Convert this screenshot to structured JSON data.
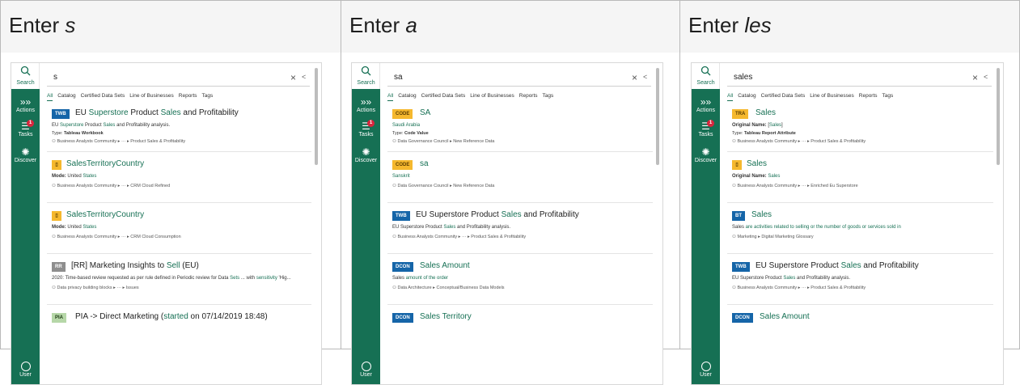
{
  "headers": [
    {
      "prefix": "Enter ",
      "term": "s"
    },
    {
      "prefix": "Enter ",
      "term": "a"
    },
    {
      "prefix": "Enter ",
      "term": "les"
    }
  ],
  "rail": {
    "search": "Search",
    "actions": "Actions",
    "tasks": "Tasks",
    "tasks_badge": "1",
    "discover": "Discover",
    "user": "User"
  },
  "tabs": [
    "All",
    "Catalog",
    "Certified Data Sets",
    "Line of Businesses",
    "Reports",
    "Tags"
  ],
  "panels": [
    {
      "query": "s",
      "results": [
        {
          "badge": "TWB",
          "title_parts": [
            "EU ",
            "Superstore",
            " Product ",
            "Sales",
            " and Profitability"
          ],
          "line1_parts": [
            "EU ",
            "Superstore",
            " Product ",
            "Sales",
            " and Profitability analysis."
          ],
          "line2_label": "Type:",
          "line2_value": "Tableau Workbook",
          "line3": "Business Analysts Community ▸ ··· ▸ Product Sales & Profitability"
        },
        {
          "badge": "▯",
          "title": "SalesTerritoryCountry",
          "line1_label": "Mode:",
          "line1_value_parts": [
            "United ",
            "States"
          ],
          "line3": "Business Analysts Community ▸ ··· ▸ CRM Cloud Refined"
        },
        {
          "badge": "▯",
          "title": "SalesTerritoryCountry",
          "line1_label": "Mode:",
          "line1_value_parts": [
            "United ",
            "States"
          ],
          "line3": "Business Analysts Community ▸ ··· ▸ CRM Cloud Consumption"
        },
        {
          "badge": "RR",
          "title_parts": [
            "[RR] Marketing Insights to ",
            "Sell",
            " (EU)"
          ],
          "line1_parts": [
            "2020: Time-based review requested as per rule defined in Periodic review for Data ",
            "Sets",
            " ... with ",
            "sensitivity",
            " 'Hig..."
          ],
          "line3": "Data privacy building blocks ▸ ··· ▸ Issues"
        },
        {
          "badge": "PIA",
          "title_parts": [
            "PIA -> Direct Marketing (",
            "started",
            " on 07/14/2019 18:48)"
          ]
        }
      ]
    },
    {
      "query": "sa",
      "results": [
        {
          "badge": "CODE",
          "title": "SA",
          "line1": "Saudi Arabia",
          "line2_label": "Type:",
          "line2_value": "Code Value",
          "line3": "Data Governance Council ▸ New Reference Data"
        },
        {
          "badge": "CODE",
          "title": "sa",
          "line1": "Sanskrit",
          "line3": "Data Governance Council ▸ New Reference Data"
        },
        {
          "badge": "TWB",
          "title_parts": [
            "EU Superstore Product ",
            "Sales",
            " and Profitability"
          ],
          "line1_parts": [
            "EU Superstore Product ",
            "Sales",
            " and Profitability analysis."
          ],
          "line3": "Business Analysts Community ▸ ··· ▸ Product Sales & Profitability"
        },
        {
          "badge": "DCON",
          "title": "Sales Amount",
          "line1_parts": [
            "Sales",
            " amount of the order"
          ],
          "line3": "Data Architecture ▸ Conceptual/Business Data Models"
        },
        {
          "badge": "DCON",
          "title": "Sales Territory"
        }
      ]
    },
    {
      "query": "sales",
      "results": [
        {
          "badge": "TRA",
          "title": "Sales",
          "line1_label": "Original Name:",
          "line1_value_parts": [
            "[",
            "Sales",
            "]"
          ],
          "line2_label": "Type:",
          "line2_value": "Tableau Report Attribute",
          "line3": "Business Analysts Community ▸ ··· ▸ Product Sales & Profitability"
        },
        {
          "badge": "▯",
          "title": "Sales",
          "line1_label": "Original Name:",
          "line1_value_parts": [
            "",
            "Sales",
            ""
          ],
          "line3": "Business Analysts Community ▸ ··· ▸ Enriched Eu Superstore"
        },
        {
          "badge": "BT",
          "title": "Sales",
          "line1_parts": [
            "Sales",
            " are activities related to selling or the number of goods or services sold in"
          ],
          "line3": "Marketing ▸ Digital Marketing Glossary"
        },
        {
          "badge": "TWB",
          "title_parts": [
            "EU Superstore Product ",
            "Sales",
            " and Profitability"
          ],
          "line1_parts": [
            "EU Superstore Product ",
            "Sales",
            " and Profitability analysis."
          ],
          "line3": "Business Analysts Community ▸ ··· ▸ Product Sales & Profitability"
        },
        {
          "badge": "DCON",
          "title": "Sales Amount"
        }
      ]
    }
  ],
  "colors": {
    "accent": "#167054",
    "twb": "#1565a8",
    "code": "#f5b82e",
    "badge_red": "#d7263d"
  }
}
